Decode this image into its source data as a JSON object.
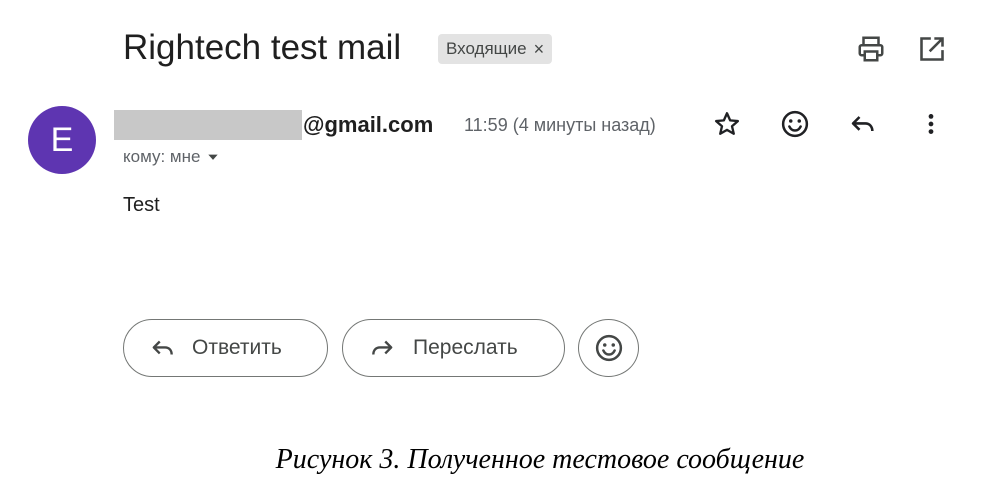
{
  "thread": {
    "subject": "Rightech test mail",
    "label": "Входящие",
    "label_remove": "×"
  },
  "message": {
    "avatar_letter": "E",
    "sender_domain": "@gmail.com",
    "time": "11:59 (4 минуты назад)",
    "recipient": "кому: мне",
    "body": "Test"
  },
  "actions": {
    "reply_label": "Ответить",
    "forward_label": "Переслать"
  },
  "caption": "Рисунок 3. Полученное тестовое сообщение",
  "colors": {
    "avatar": "#5e35b1",
    "chip_bg": "#e3e3e3"
  },
  "icons": [
    "print-icon",
    "open-in-new-window-icon",
    "star-icon",
    "emoji-icon",
    "reply-icon",
    "more-vert-icon",
    "forward-icon"
  ]
}
